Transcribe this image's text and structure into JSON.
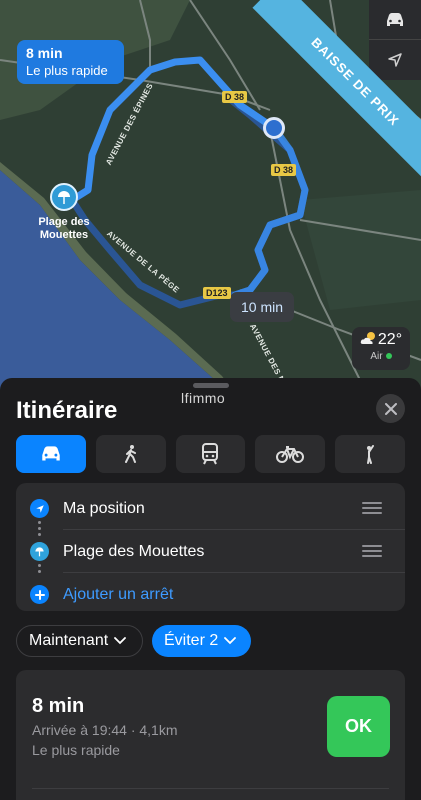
{
  "map": {
    "route_time": "8 min",
    "route_note": "Le plus rapide",
    "alt_route_time": "10 min",
    "roads": [
      "D 38",
      "D 38",
      "D123"
    ],
    "streets": [
      "AVENUE DES ÉPINES",
      "AVENUE DE LA PÈGE",
      "AVENUE DES MIMO"
    ],
    "poi": {
      "line1": "Plage des",
      "line2": "Mouettes",
      "icon": "beach-umbrella-icon"
    },
    "weather": {
      "temp": "22°",
      "air_label": "Air",
      "air_status_color": "#34c759"
    },
    "ribbon": "BAISSE DE PRIX",
    "controls": [
      "car-icon",
      "location-arrow-icon"
    ]
  },
  "sheet": {
    "logo": "lfimmo",
    "title": "Itinéraire",
    "modes": [
      {
        "name": "car",
        "icon": "car-icon",
        "active": true
      },
      {
        "name": "walk",
        "icon": "walking-person-icon",
        "active": false
      },
      {
        "name": "transit",
        "icon": "train-icon",
        "active": false
      },
      {
        "name": "bike",
        "icon": "bicycle-icon",
        "active": false
      },
      {
        "name": "rideshare",
        "icon": "person-hailing-icon",
        "active": false
      }
    ],
    "stops": [
      {
        "label": "Ma position",
        "icon": "location-arrow-icon"
      },
      {
        "label": "Plage des Mouettes",
        "icon": "beach-umbrella-icon"
      }
    ],
    "add_stop": "Ajouter un arrêt",
    "departure": "Maintenant",
    "avoid": "Éviter 2",
    "route": {
      "time": "8 min",
      "arrival": "Arrivée à 19:44 · 4,1km",
      "note": "Le plus rapide",
      "ok": "OK"
    }
  },
  "colors": {
    "accent": "#0a84ff",
    "ok": "#34c759",
    "route": "#3b8ef0",
    "sheet_bg": "#1c1c1e",
    "card_bg": "#2c2c2e"
  }
}
